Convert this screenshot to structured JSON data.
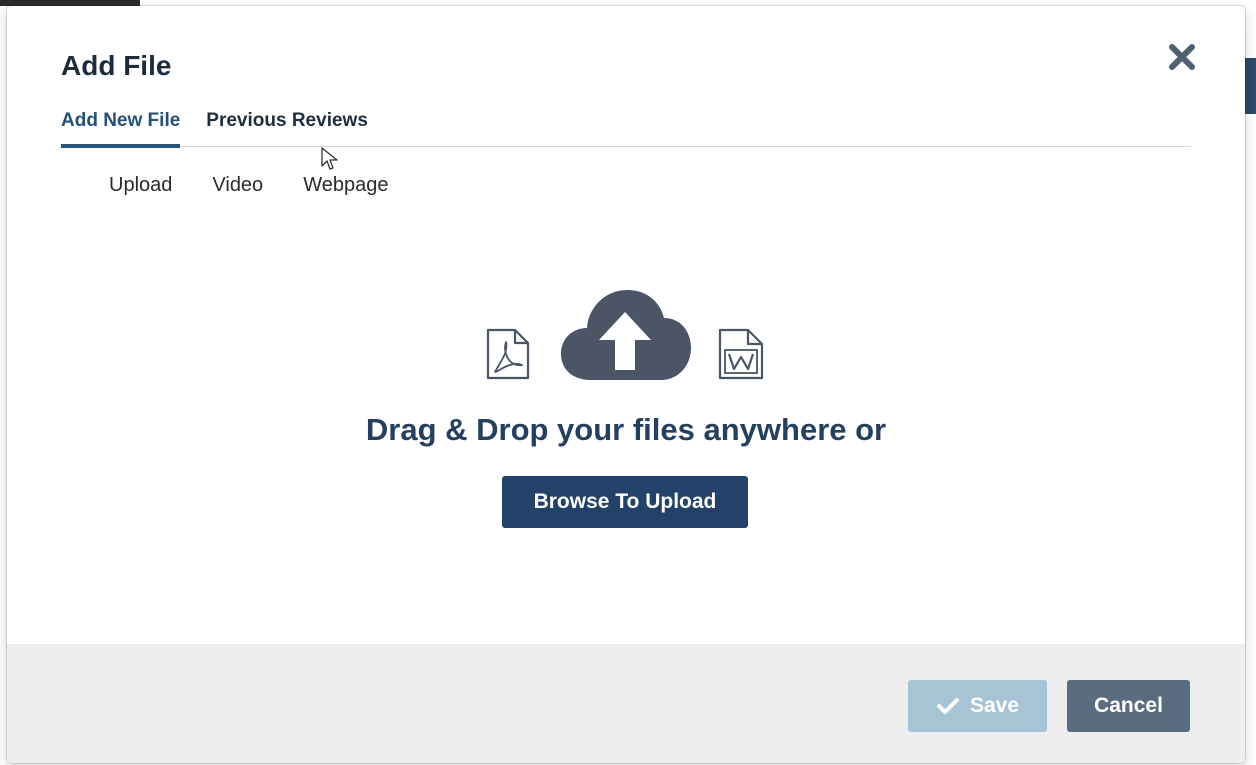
{
  "dialog": {
    "title": "Add File",
    "close_icon": "close-icon"
  },
  "tabs": [
    {
      "label": "Add New File",
      "active": true
    },
    {
      "label": "Previous Reviews",
      "active": false
    }
  ],
  "subtabs": [
    {
      "label": "Upload"
    },
    {
      "label": "Video"
    },
    {
      "label": "Webpage"
    }
  ],
  "dropzone": {
    "icons": [
      "pdf-file-icon",
      "cloud-upload-icon",
      "word-file-icon"
    ],
    "text": "Drag & Drop your files anywhere or",
    "browse_label": "Browse To Upload"
  },
  "footer": {
    "save_label": "Save",
    "save_icon": "check-icon",
    "cancel_label": "Cancel"
  },
  "colors": {
    "primary": "#23426a",
    "active_tab": "#24507a",
    "save_disabled": "#a6c4d6",
    "cancel": "#5a6d80",
    "icon": "#4b5565",
    "footer_bg": "#eeeeee"
  }
}
